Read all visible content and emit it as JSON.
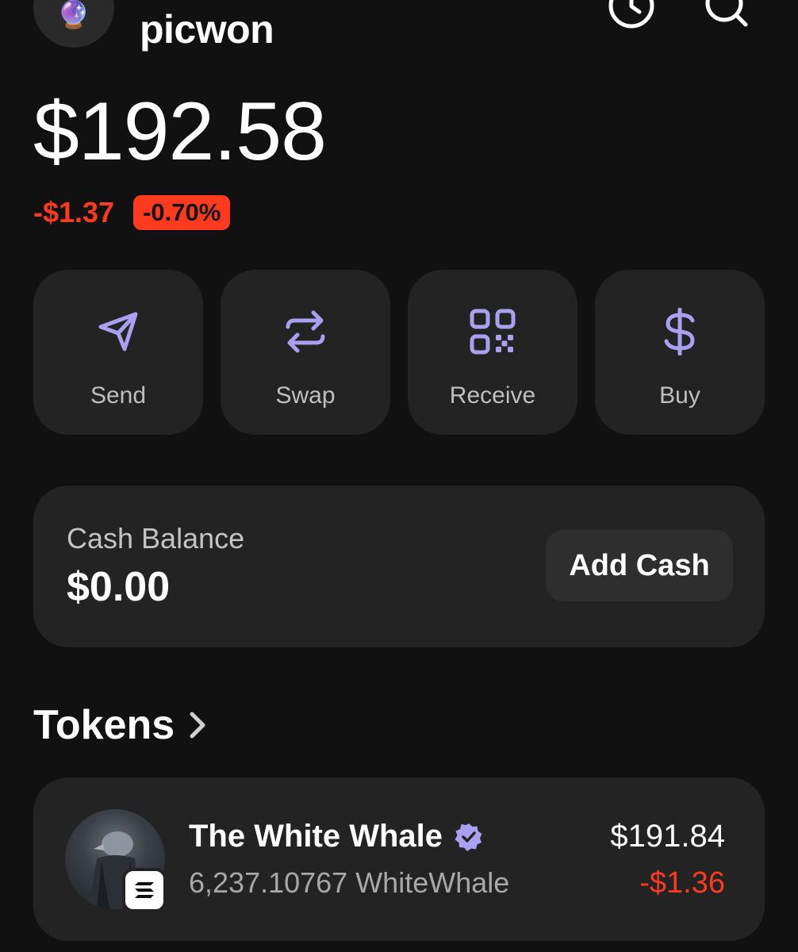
{
  "header": {
    "avatar_emoji": "🔮",
    "username": "picwon"
  },
  "portfolio": {
    "balance": "$192.58",
    "change_amount": "-$1.37",
    "change_percent": "-0.70%"
  },
  "actions": [
    {
      "label": "Send",
      "icon": "send-icon"
    },
    {
      "label": "Swap",
      "icon": "swap-icon"
    },
    {
      "label": "Receive",
      "icon": "qr-code-icon"
    },
    {
      "label": "Buy",
      "icon": "dollar-icon"
    }
  ],
  "cash": {
    "label": "Cash Balance",
    "value": "$0.00",
    "button_label": "Add Cash"
  },
  "tokens": {
    "title": "Tokens",
    "items": [
      {
        "name": "The White Whale",
        "amount": "6,237.10767 WhiteWhale",
        "value": "$191.84",
        "change": "-$1.36"
      }
    ]
  },
  "colors": {
    "accent": "#ab9ff2",
    "negative": "#ff3b1f",
    "background": "#111111",
    "card": "#232323"
  }
}
